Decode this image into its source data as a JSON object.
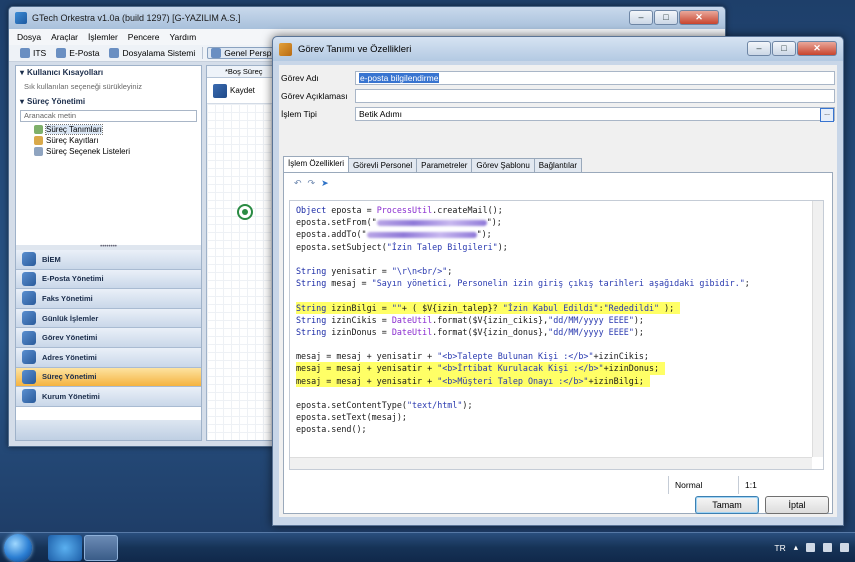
{
  "main_window": {
    "title": "GTech Orkestra v1.0a (build 1297) [G-YAZILIM A.S.]",
    "window_buttons": [
      "–",
      "□",
      "✕"
    ],
    "menu": [
      "Dosya",
      "Araçlar",
      "İşlemler",
      "Pencere",
      "Yardım"
    ],
    "toolbar": [
      "ITS",
      "E-Posta",
      "Dosyalama Sistemi",
      "Genel Perspektif"
    ],
    "nav": {
      "shortcuts_header": "Kullanıcı Kısayolları",
      "shortcuts_hint": "Sık kullanılan seçeneği sürükleyiniz",
      "process_header": "Süreç Yönetimi",
      "search_placeholder": "Aranacak metin",
      "tree": [
        "Süreç Tanımları",
        "Süreç Kayıtları",
        "Süreç Seçenek Listeleri"
      ],
      "modules": [
        "BİEM",
        "E-Posta Yönetimi",
        "Faks Yönetimi",
        "Günlük İşlemler",
        "Görev Yönetimi",
        "Adres Yönetimi",
        "Süreç Yönetimi",
        "Kurum Yönetimi"
      ],
      "active_module": "Süreç Yönetimi"
    },
    "editor": {
      "tab": "*Boş Süreç",
      "save_label": "Kaydet"
    }
  },
  "dialog": {
    "title": "Görev Tanımı ve Özellikleri",
    "window_buttons": [
      "–",
      "□",
      "✕"
    ],
    "fields": {
      "task_name_label": "Görev Adı",
      "task_name_value": "e-posta bilgilendirme",
      "task_desc_label": "Görev Açıklaması",
      "task_desc_value": "",
      "op_type_label": "İşlem Tipi",
      "op_type_value": "Betik Adımı",
      "browse_label": "..."
    },
    "tabs": [
      "İşlem Özellikleri",
      "Görevli Personel",
      "Parametreler",
      "Görev Şablonu",
      "Bağlantılar"
    ],
    "active_tab": "İşlem Özellikleri",
    "code": [
      {
        "text": "Object eposta = ProcessUtil.createMail();",
        "highlight": false
      },
      {
        "text": "eposta.setFrom(\"█████████████████\");",
        "highlight": false,
        "redacted": true
      },
      {
        "text": "eposta.addTo(\"█████████████████\");",
        "highlight": false,
        "redacted": true
      },
      {
        "text": "eposta.setSubject(\"İzin Talep Bilgileri\");",
        "highlight": false
      },
      {
        "text": "",
        "highlight": false
      },
      {
        "text": "String yenisatir = \"\\r\\n<br/>\";",
        "highlight": false
      },
      {
        "text": "String mesaj = \"Sayın yönetici, Personelin izin giriş çıkış tarihleri aşağıdaki gibidir.\";",
        "highlight": false
      },
      {
        "text": "",
        "highlight": false
      },
      {
        "text": "String izinBilgi = \"\"+ ( $V{izin_talep}? \"İzin Kabul Edildi\":\"Rededildi\" );",
        "highlight": true
      },
      {
        "text": "String izinCikis = DateUtil.format($V{izin_cikis},\"dd/MM/yyyy EEEE\");",
        "highlight": false
      },
      {
        "text": "String izinDonus = DateUtil.format($V{izin_donus},\"dd/MM/yyyy EEEE\");",
        "highlight": false
      },
      {
        "text": "",
        "highlight": false
      },
      {
        "text": "mesaj = mesaj + yenisatir + \"<b>Talepte Bulunan Kişi :</b>\"+izinCikis;",
        "highlight": false
      },
      {
        "text": "mesaj = mesaj + yenisatir + \"<b>İrtibat Kurulacak Kişi :</b>\"+izinDonus;",
        "highlight": true
      },
      {
        "text": "mesaj = mesaj + yenisatir + \"<b>Müşteri Talep Onayı :</b>\"+izinBilgi;",
        "highlight": true
      },
      {
        "text": "",
        "highlight": false
      },
      {
        "text": "eposta.setContentType(\"text/html\");",
        "highlight": false
      },
      {
        "text": "eposta.setText(mesaj);",
        "highlight": false
      },
      {
        "text": "eposta.send();",
        "highlight": false
      }
    ],
    "status": {
      "mode": "Normal",
      "position": "1:1"
    },
    "buttons": {
      "ok": "Tamam",
      "cancel": "İptal"
    }
  },
  "taskbar": {
    "tray": {
      "language": "TR"
    }
  }
}
